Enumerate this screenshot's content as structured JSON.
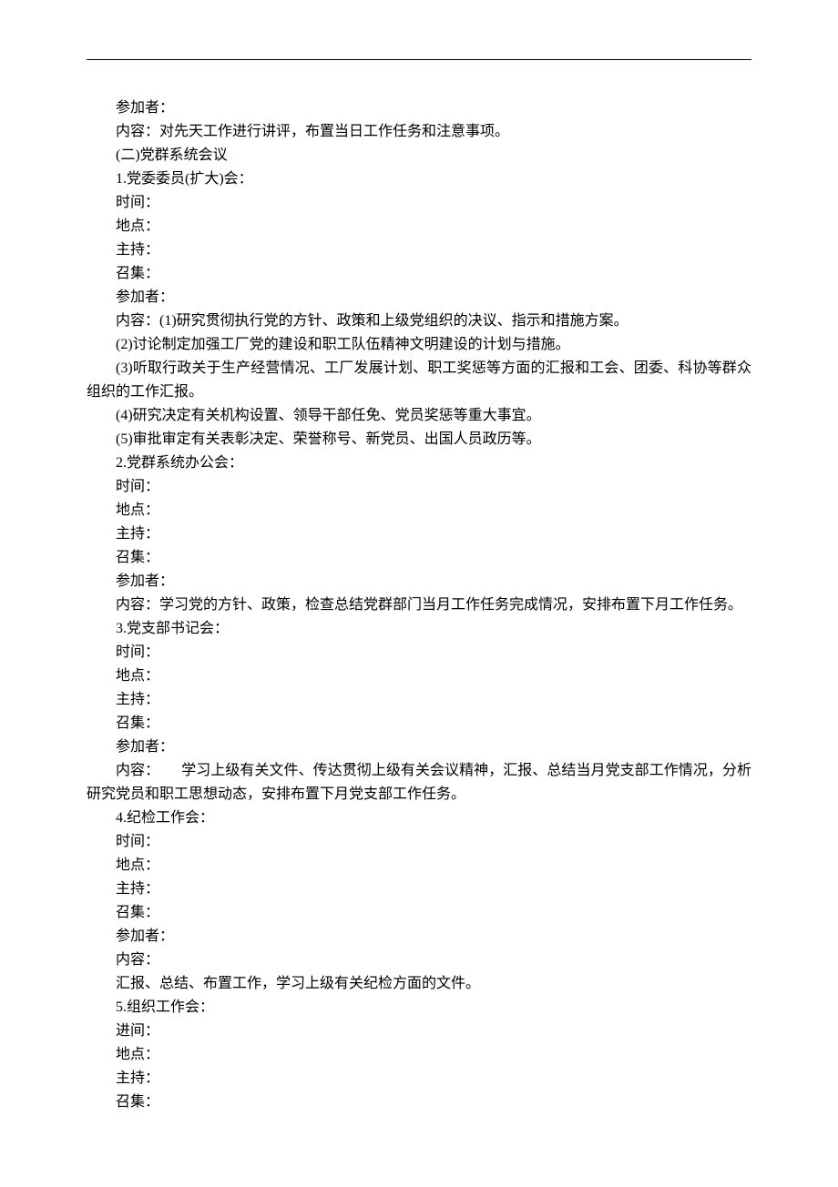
{
  "lines": [
    "参加者：",
    "内容：对先天工作进行讲评，布置当日工作任务和注意事项。",
    "(二)党群系统会议",
    "1.党委委员(扩大)会：",
    "时间：",
    "地点：",
    "主持：",
    "召集：",
    "参加者：",
    "内容：(1)研究贯彻执行党的方针、政策和上级党组织的决议、指示和措施方案。",
    "(2)讨论制定加强工厂党的建设和职工队伍精神文明建设的计划与措施。"
  ],
  "block1": "(3)听取行政关于生产经营情况、工厂发展计划、职工奖惩等方面的汇报和工会、团委、科协等群众组织的工作汇报。",
  "lines2": [
    "(4)研究决定有关机构设置、领导干部任免、党员奖惩等重大事宜。",
    "(5)审批审定有关表彰决定、荣誉称号、新党员、出国人员政历等。",
    "2.党群系统办公会：",
    "时间：",
    "地点：",
    "主持：",
    "召集：",
    "参加者："
  ],
  "block2": "内容：学习党的方针、政策，检查总结党群部门当月工作任务完成情况，安排布置下月工作任务。",
  "lines3": [
    "3.党支部书记会：",
    "时间：",
    "地点：",
    "主持：",
    "召集：",
    "参加者："
  ],
  "block3": "内容：　　学习上级有关文件、传达贯彻上级有关会议精神，汇报、总结当月党支部工作情况，分析研究党员和职工思想动态，安排布置下月党支部工作任务。",
  "lines4": [
    "4.纪检工作会：",
    "时间：",
    "地点：",
    "主持：",
    "召集：",
    "参加者：",
    "内容：",
    "汇报、总结、布置工作，学习上级有关纪检方面的文件。",
    "5.组织工作会：",
    "进间：",
    "地点：",
    "主持：",
    "召集："
  ]
}
